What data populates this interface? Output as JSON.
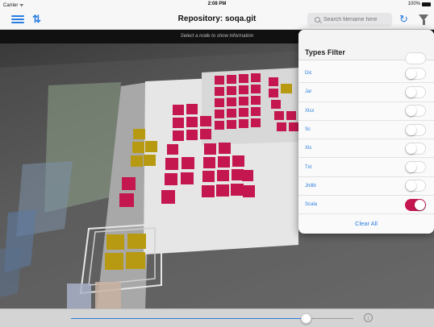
{
  "status_bar": {
    "carrier": "Carrier ᯤ",
    "time": "2:08 PM",
    "battery": "100%"
  },
  "nav": {
    "title": "Repository: soqa.git",
    "search_placeholder": "Search filename here",
    "icons": [
      "menu-icon",
      "sync-icon",
      "search-icon",
      "refresh-icon",
      "filter-icon"
    ]
  },
  "info_bar": {
    "text": "Select a node to show information"
  },
  "filter_panel": {
    "title": "Types Filter",
    "rows": [
      {
        "label": "Dic",
        "on": false
      },
      {
        "label": "Jar",
        "on": false
      },
      {
        "label": "Xlsx",
        "on": false
      },
      {
        "label": "Sc",
        "on": false
      },
      {
        "label": "Xls",
        "on": false
      },
      {
        "label": "Txt",
        "on": false
      },
      {
        "label": "Jnilib",
        "on": false
      },
      {
        "label": "Scala",
        "on": true
      }
    ],
    "clear_all": "Clear All"
  },
  "slider": {
    "value_fraction": 0.83
  },
  "colors": {
    "accent": "#2a7de1",
    "toggle_on": "#c4174f",
    "scala_block": "#c4174f",
    "other_block": "#b89a12"
  }
}
